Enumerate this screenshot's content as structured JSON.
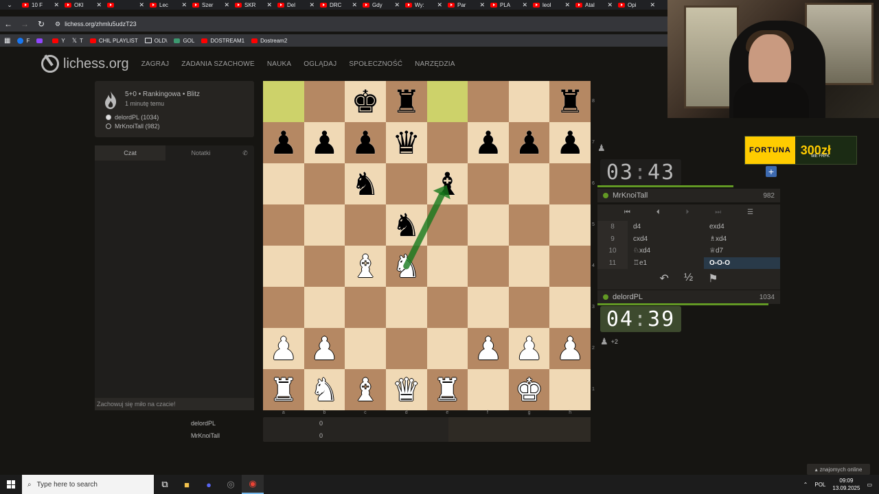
{
  "browser": {
    "tabs": [
      "10 F",
      "OKI",
      "",
      "Lec",
      "Szer",
      "SKR",
      "Del",
      "DRC",
      "Gdy",
      "Wy:",
      "Par",
      "PLA",
      "leol",
      "Atal",
      "Opi"
    ],
    "url": "lichess.org/zhmlu5udzT23",
    "bookmarks": [
      "F",
      "",
      "Y",
      "T",
      "CHIL PLAYLIST",
      "OLD\\",
      "GOL",
      "DOSTREAM1",
      "Dostream2"
    ]
  },
  "header": {
    "logo": "lichess.org",
    "menu": [
      "ZAGRAJ",
      "ZADANIA SZACHOWE",
      "NAUKA",
      "OGLĄDAJ",
      "SPOŁECZNOŚĆ",
      "NARZĘDZIA"
    ]
  },
  "game_info": {
    "title": "5+0 • Rankingowa • Blitz",
    "time_ago": "1 minutę temu",
    "white_player": "delordPL (1034)",
    "black_player": "MrKnoiTall (982)"
  },
  "chat": {
    "tab_chat": "Czat",
    "tab_notes": "Notatki",
    "placeholder": "Zachowuj się miło na czacie!"
  },
  "board": {
    "ranks": [
      "8",
      "7",
      "6",
      "5",
      "4",
      "3",
      "2",
      "1"
    ],
    "files": [
      "a",
      "b",
      "c",
      "d",
      "e",
      "f",
      "g",
      "h"
    ],
    "position": [
      [
        "",
        "",
        "bk",
        "br",
        "",
        "",
        "",
        "br"
      ],
      [
        "bp",
        "bp",
        "bp",
        "bq",
        "",
        "bp",
        "bp",
        "bp"
      ],
      [
        "",
        "",
        "bn",
        "",
        "bb",
        "",
        "",
        ""
      ],
      [
        "",
        "",
        "",
        "bn",
        "",
        "",
        "",
        ""
      ],
      [
        "",
        "",
        "wb",
        "wn",
        "",
        "",
        "",
        ""
      ],
      [
        "",
        "",
        "",
        "",
        "",
        "",
        "",
        ""
      ],
      [
        "wp",
        "wp",
        "",
        "",
        "",
        "wp",
        "wp",
        "wp"
      ],
      [
        "wr",
        "wn",
        "wb",
        "wq",
        "wr",
        "",
        "wk",
        ""
      ]
    ],
    "highlights": [
      "a8",
      "e8"
    ],
    "arrow": {
      "from": "d4",
      "to": "e6",
      "color": "#15781b"
    }
  },
  "scores": [
    {
      "name": "delordPL",
      "score": "0"
    },
    {
      "name": "MrKnoiTall",
      "score": "0"
    }
  ],
  "top_player": {
    "name": "MrKnoiTall",
    "rating": "982",
    "clock_min": "03",
    "clock_sec": "43"
  },
  "bottom_player": {
    "name": "delordPL",
    "rating": "1034",
    "clock_min": "04",
    "clock_sec": "39"
  },
  "moves": [
    {
      "no": "8",
      "white": "d4",
      "black": "exd4"
    },
    {
      "no": "9",
      "white": "cxd4",
      "black": "♗xd4"
    },
    {
      "no": "10",
      "white": "♘xd4",
      "black": "♕d7"
    },
    {
      "no": "11",
      "white": "♖e1",
      "black": "O-O-O"
    }
  ],
  "material_diff": "+2",
  "sponsor": {
    "brand": "FORTUNA",
    "amount": "300zł",
    "sub": "WE FRFK"
  },
  "online": "znajomych online",
  "taskbar": {
    "search_placeholder": "Type here to search",
    "lang": "POL",
    "time": "09:09",
    "date": "13.09.2025"
  }
}
